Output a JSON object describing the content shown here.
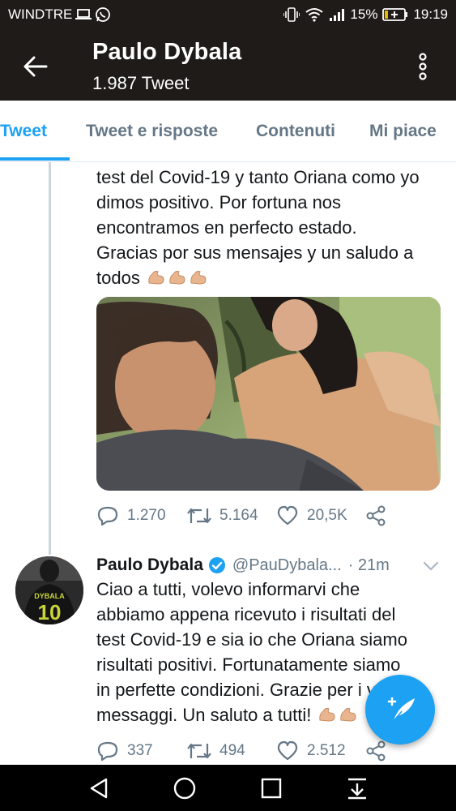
{
  "status_bar": {
    "carrier": "WINDTRE",
    "battery_percent": "15%",
    "time": "19:19",
    "icons": [
      "laptop-icon",
      "whatsapp-icon",
      "vibrate-icon",
      "wifi-icon",
      "signal-icon",
      "battery-icon"
    ]
  },
  "header": {
    "title": "Paulo Dybala",
    "subtitle": "1.987 Tweet",
    "back_icon": "arrow-left-icon",
    "menu_icon": "more-vertical-icon"
  },
  "tabs": [
    {
      "label": "Tweet",
      "active": true
    },
    {
      "label": "Tweet e risposte",
      "active": false
    },
    {
      "label": "Contenuti",
      "active": false
    },
    {
      "label": "Mi piace",
      "active": false
    }
  ],
  "tweet1": {
    "lines": [
      "test del Covid-19 y tanto Oriana como yo",
      "dimos positivo. Por fortuna nos",
      "encontramos en perfecto estado.",
      "Gracias por sus mensajes y un saludo a",
      "todos"
    ],
    "stats": {
      "replies": "1.270",
      "retweets": "5.164",
      "likes": "20,5K"
    }
  },
  "tweet2": {
    "name": "Paulo Dybala",
    "handle": "@PauDybala...",
    "time": "· 21m",
    "lines": [
      "Ciao a tutti, volevo informarvi che",
      "abbiamo appena ricevuto i risultati del",
      "test Covid-19 e sia io che Oriana siamo",
      "risultati positivi. Fortunatamente siamo",
      "in perfette condizioni. Grazie per i vostri",
      "messaggi. Un saluto a tutti!"
    ],
    "stats": {
      "replies": "337",
      "retweets": "494",
      "likes": "2.512"
    },
    "avatar_jersey_name": "DYBALA",
    "avatar_jersey_number": "10"
  },
  "fab": {
    "icon": "compose-feather-icon"
  },
  "nav": {
    "icons": [
      "back-triangle-icon",
      "home-circle-icon",
      "recents-square-icon",
      "notification-pull-icon"
    ]
  },
  "colors": {
    "accent": "#1da1f2",
    "bar_dark": "#1e1b18",
    "text": "#14171a",
    "muted": "#657786"
  }
}
